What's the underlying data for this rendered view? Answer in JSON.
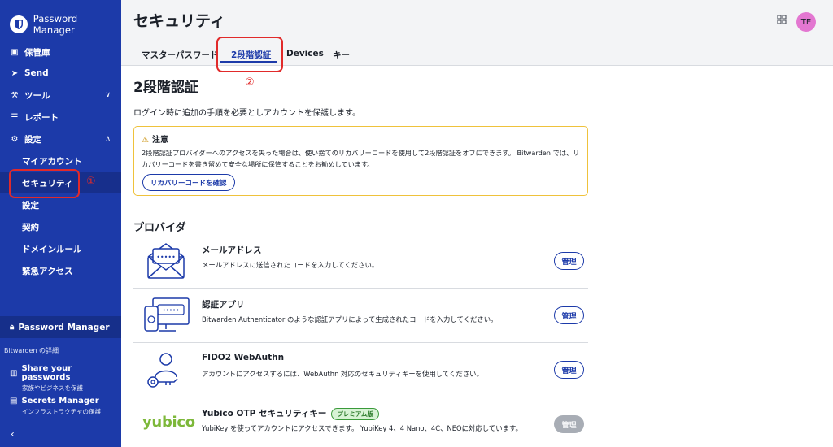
{
  "app": {
    "title": "Password Manager"
  },
  "sidebar": {
    "items": [
      {
        "label": "保管庫",
        "icon": "vault-icon"
      },
      {
        "label": "Send",
        "icon": "send-icon"
      },
      {
        "label": "ツール",
        "icon": "wrench-icon"
      },
      {
        "label": "レポート",
        "icon": "sliders-icon"
      },
      {
        "label": "設定",
        "icon": "gear-icon"
      }
    ],
    "settings_sub": [
      {
        "label": "マイアカウント"
      },
      {
        "label": "セキュリティ"
      },
      {
        "label": "設定"
      },
      {
        "label": "契約"
      },
      {
        "label": "ドメインルール"
      },
      {
        "label": "緊急アクセス"
      }
    ],
    "product_switch": "Password Manager",
    "caption": "Bitwarden の詳細",
    "promos": [
      {
        "title": "Share your passwords",
        "subtitle": "家族やビジネスを保護"
      },
      {
        "title": "Secrets Manager",
        "subtitle": "インフラストラクチャの保護"
      }
    ]
  },
  "annotations": {
    "marker1": "①",
    "marker2": "②"
  },
  "header": {
    "title": "セキュリティ",
    "avatar": "TE",
    "tabs": [
      {
        "label": "マスターパスワード"
      },
      {
        "label": "2段階認証"
      },
      {
        "label": "Devices"
      },
      {
        "label": "キー"
      }
    ]
  },
  "main": {
    "title": "2段階認証",
    "description": "ログイン時に追加の手順を必要としアカウントを保護します。",
    "warning": {
      "title": "注意",
      "body": "2段階認証プロバイダーへのアクセスを失った場合は、使い捨てのリカバリーコードを使用して2段階認証をオフにできます。 Bitwarden では、リカバリーコードを書き留めて安全な場所に保管することをお勧めしています。",
      "button": "リカバリーコードを確認"
    },
    "providers_heading": "プロバイダ",
    "providers": [
      {
        "name": "メールアドレス",
        "desc": "メールアドレスに送信されたコードを入力してください。",
        "button": "管理",
        "icon": "email-envelope-icon"
      },
      {
        "name": "認証アプリ",
        "desc": "Bitwarden Authenticator のような認証アプリによって生成されたコードを入力してください。",
        "button": "管理",
        "icon": "authenticator-app-icon"
      },
      {
        "name": "FIDO2 WebAuthn",
        "desc": "アカウントにアクセスするには、WebAuthn 対応のセキュリティキーを使用してください。",
        "button": "管理",
        "icon": "security-key-icon"
      },
      {
        "name": "Yubico OTP セキュリティキー",
        "badge": "プレミアム版",
        "desc": "YubiKey を使ってアカウントにアクセスできます。 YubiKey 4、4 Nano、4C、NEOに対応しています。",
        "button": "管理",
        "logo": "yubico"
      }
    ]
  },
  "colors": {
    "brand": "#1c3aa9",
    "warning": "#efc23b",
    "annotation": "#e12a2a"
  }
}
